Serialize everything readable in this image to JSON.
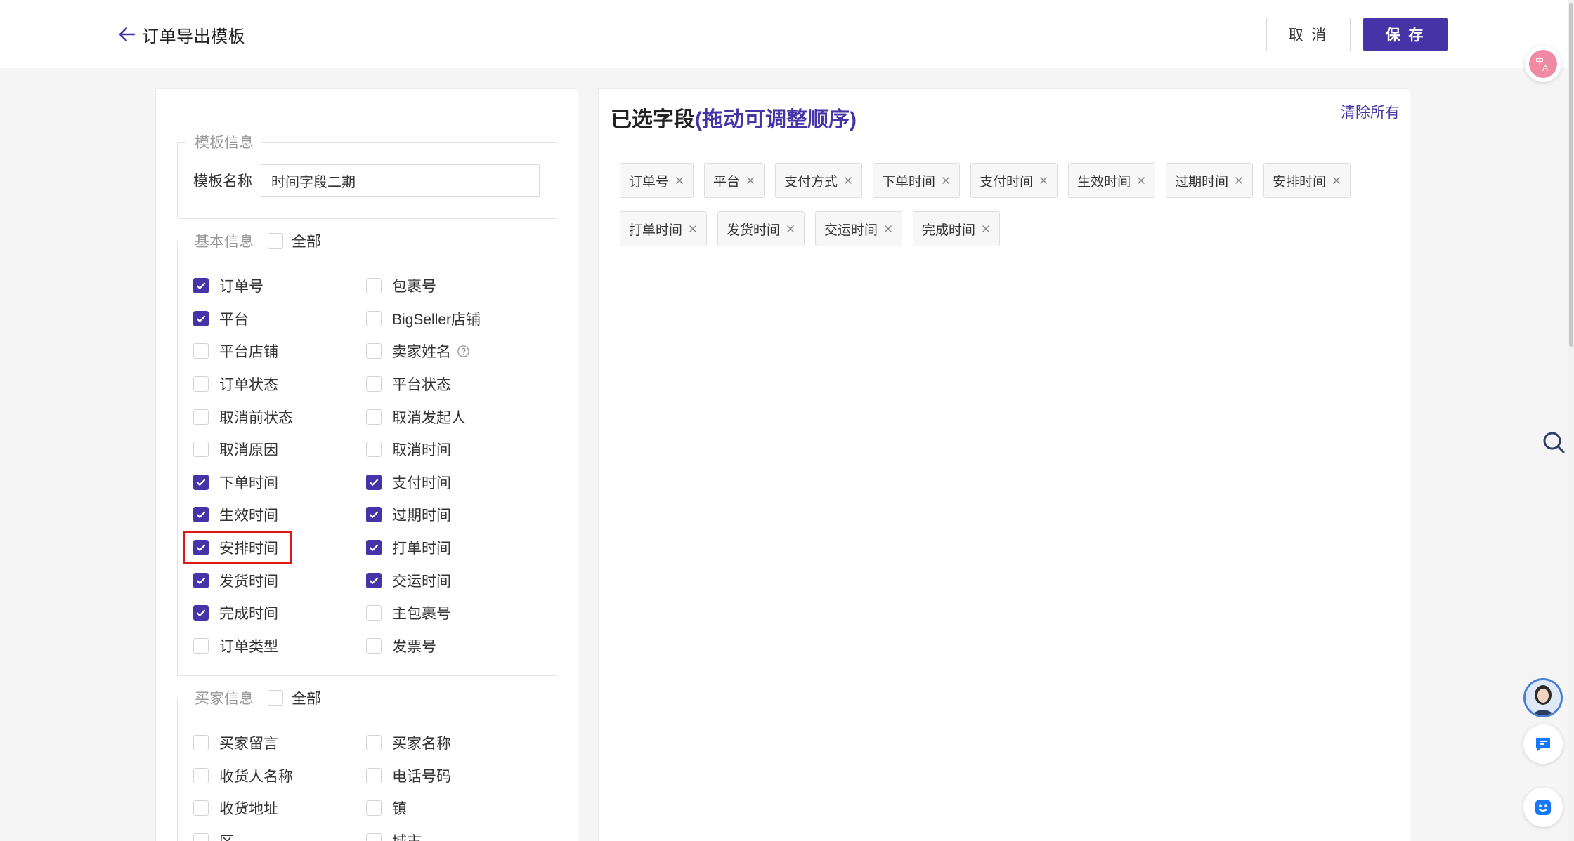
{
  "header": {
    "title": "订单导出模板",
    "cancel_label": "取 消",
    "save_label": "保 存"
  },
  "template_info": {
    "legend": "模板信息",
    "name_label": "模板名称",
    "name_value": "时间字段二期"
  },
  "basic_info": {
    "legend": "基本信息",
    "select_all_label": "全部",
    "select_all_checked": false,
    "fields": [
      {
        "label": "订单号",
        "checked": true
      },
      {
        "label": "包裹号",
        "checked": false
      },
      {
        "label": "平台",
        "checked": true
      },
      {
        "label": "BigSeller店铺",
        "checked": false
      },
      {
        "label": "平台店铺",
        "checked": false
      },
      {
        "label": "卖家姓名",
        "checked": false,
        "help": true
      },
      {
        "label": "订单状态",
        "checked": false
      },
      {
        "label": "平台状态",
        "checked": false
      },
      {
        "label": "取消前状态",
        "checked": false
      },
      {
        "label": "取消发起人",
        "checked": false
      },
      {
        "label": "取消原因",
        "checked": false
      },
      {
        "label": "取消时间",
        "checked": false
      },
      {
        "label": "下单时间",
        "checked": true
      },
      {
        "label": "支付时间",
        "checked": true
      },
      {
        "label": "生效时间",
        "checked": true
      },
      {
        "label": "过期时间",
        "checked": true
      },
      {
        "label": "安排时间",
        "checked": true,
        "highlighted": true
      },
      {
        "label": "打单时间",
        "checked": true
      },
      {
        "label": "发货时间",
        "checked": true
      },
      {
        "label": "交运时间",
        "checked": true
      },
      {
        "label": "完成时间",
        "checked": true
      },
      {
        "label": "主包裹号",
        "checked": false
      },
      {
        "label": "订单类型",
        "checked": false
      },
      {
        "label": "发票号",
        "checked": false
      }
    ]
  },
  "buyer_info": {
    "legend": "买家信息",
    "select_all_label": "全部",
    "select_all_checked": false,
    "fields": [
      {
        "label": "买家留言",
        "checked": false
      },
      {
        "label": "买家名称",
        "checked": false
      },
      {
        "label": "收货人名称",
        "checked": false
      },
      {
        "label": "电话号码",
        "checked": false
      },
      {
        "label": "收货地址",
        "checked": false
      },
      {
        "label": "镇",
        "checked": false
      },
      {
        "label": "区",
        "checked": false
      },
      {
        "label": "城市",
        "checked": false
      }
    ]
  },
  "selected": {
    "title": "已选字段",
    "hint": "(拖动可调整顺序)",
    "clear_label": "清除所有",
    "tags": [
      "订单号",
      "平台",
      "支付方式",
      "下单时间",
      "支付时间",
      "生效时间",
      "过期时间",
      "安排时间",
      "打单时间",
      "发货时间",
      "交运时间",
      "完成时间"
    ]
  },
  "colors": {
    "primary": "#4533a7",
    "highlight": "#e01818"
  },
  "icons": {
    "back": "arrow-left-icon",
    "help": "question-circle-icon",
    "tag_remove": "close-icon",
    "translate": "translate-icon",
    "search": "search-icon",
    "message": "message-icon",
    "help_float": "help-icon"
  }
}
